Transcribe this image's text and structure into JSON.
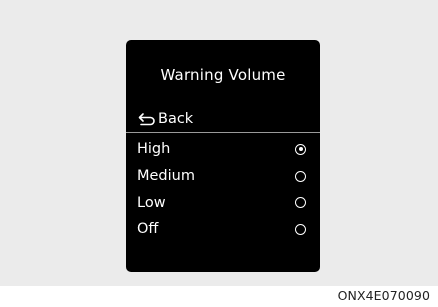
{
  "screen": {
    "title": "Warning Volume",
    "back_label": "Back",
    "back_icon": "return-arrow-icon",
    "options": [
      {
        "label": "High",
        "selected": true
      },
      {
        "label": "Medium",
        "selected": false
      },
      {
        "label": "Low",
        "selected": false
      },
      {
        "label": "Off",
        "selected": false
      }
    ]
  },
  "figure_code": "ONX4E070090",
  "colors": {
    "background": "#ebebeb",
    "screen": "#000000",
    "text": "#ffffff"
  }
}
